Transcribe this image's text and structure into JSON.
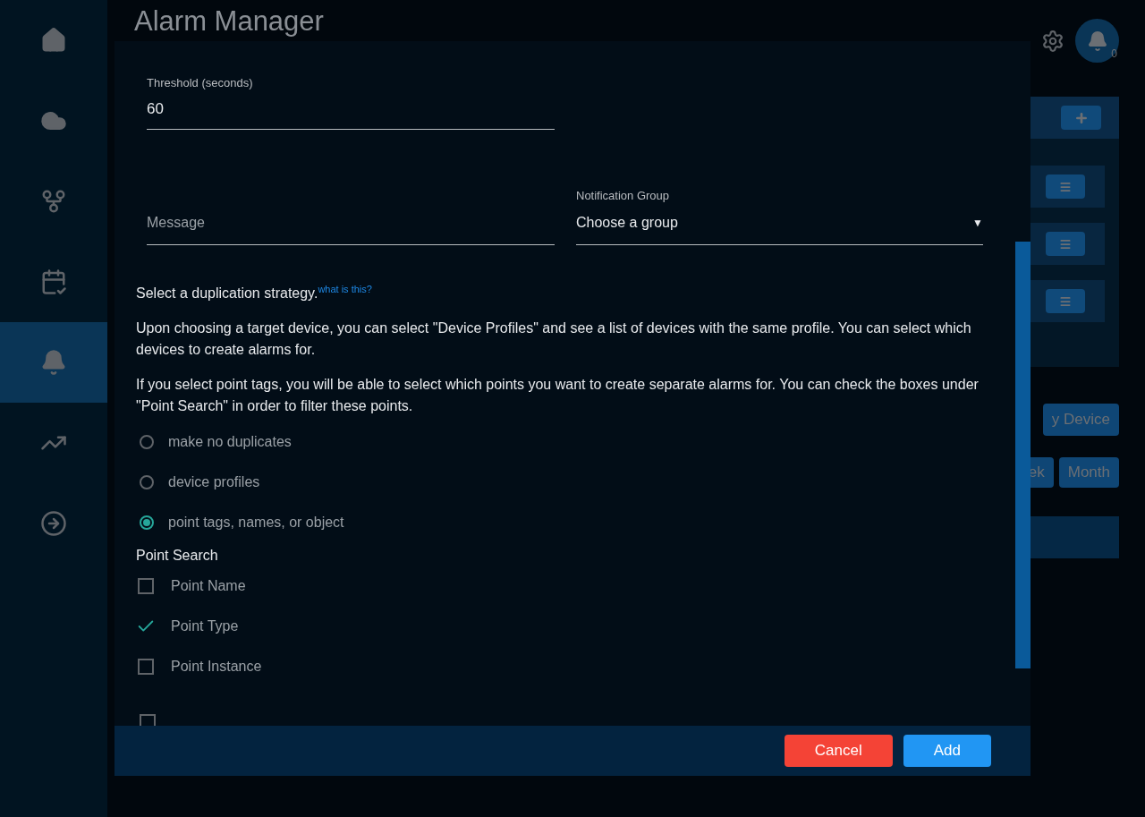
{
  "sidebar": {
    "items": [
      {
        "kind": "home",
        "selected": false
      },
      {
        "kind": "cloud",
        "selected": false
      },
      {
        "kind": "fork",
        "selected": false
      },
      {
        "kind": "calendar",
        "selected": false
      },
      {
        "kind": "bell",
        "selected": true
      },
      {
        "kind": "trend",
        "selected": false
      },
      {
        "kind": "exit",
        "selected": false
      }
    ]
  },
  "page": {
    "title": "Alarm Manager",
    "notification_count": "0",
    "side_buttons": [
      "y Device"
    ],
    "range_buttons": [
      "ek",
      "Month"
    ]
  },
  "dialog": {
    "threshold": {
      "label": "Threshold (seconds)",
      "value": "60"
    },
    "message": {
      "placeholder": "Message"
    },
    "notification_group": {
      "label": "Notification Group",
      "value": "Choose a group",
      "arrow": "▼"
    },
    "strategy_heading": "Select a duplication strategy.",
    "help_link": "what is this?",
    "paragraphs": [
      "Upon choosing a target device, you can select \"Device Profiles\" and see a list of devices with the same profile. You can select which devices to create alarms for.",
      "If you select point tags, you will be able to select which points you want to create separate alarms for. You can check the boxes under \"Point Search\" in order to filter these points."
    ],
    "strategies": [
      {
        "label": "make no duplicates",
        "selected": false
      },
      {
        "label": "device profiles",
        "selected": false
      },
      {
        "label": "point tags, names, or object",
        "selected": true
      }
    ],
    "point_search": {
      "heading": "Point Search",
      "options": [
        {
          "label": "Point Name",
          "checked": false
        },
        {
          "label": "Point Type",
          "checked": true
        },
        {
          "label": "Point Instance",
          "checked": false
        }
      ]
    },
    "table_header_checkbox": {
      "checked": false
    },
    "buttons": [
      {
        "label": "Cancel",
        "kind": "cancel"
      },
      {
        "label": "Add",
        "kind": "primary"
      }
    ]
  }
}
